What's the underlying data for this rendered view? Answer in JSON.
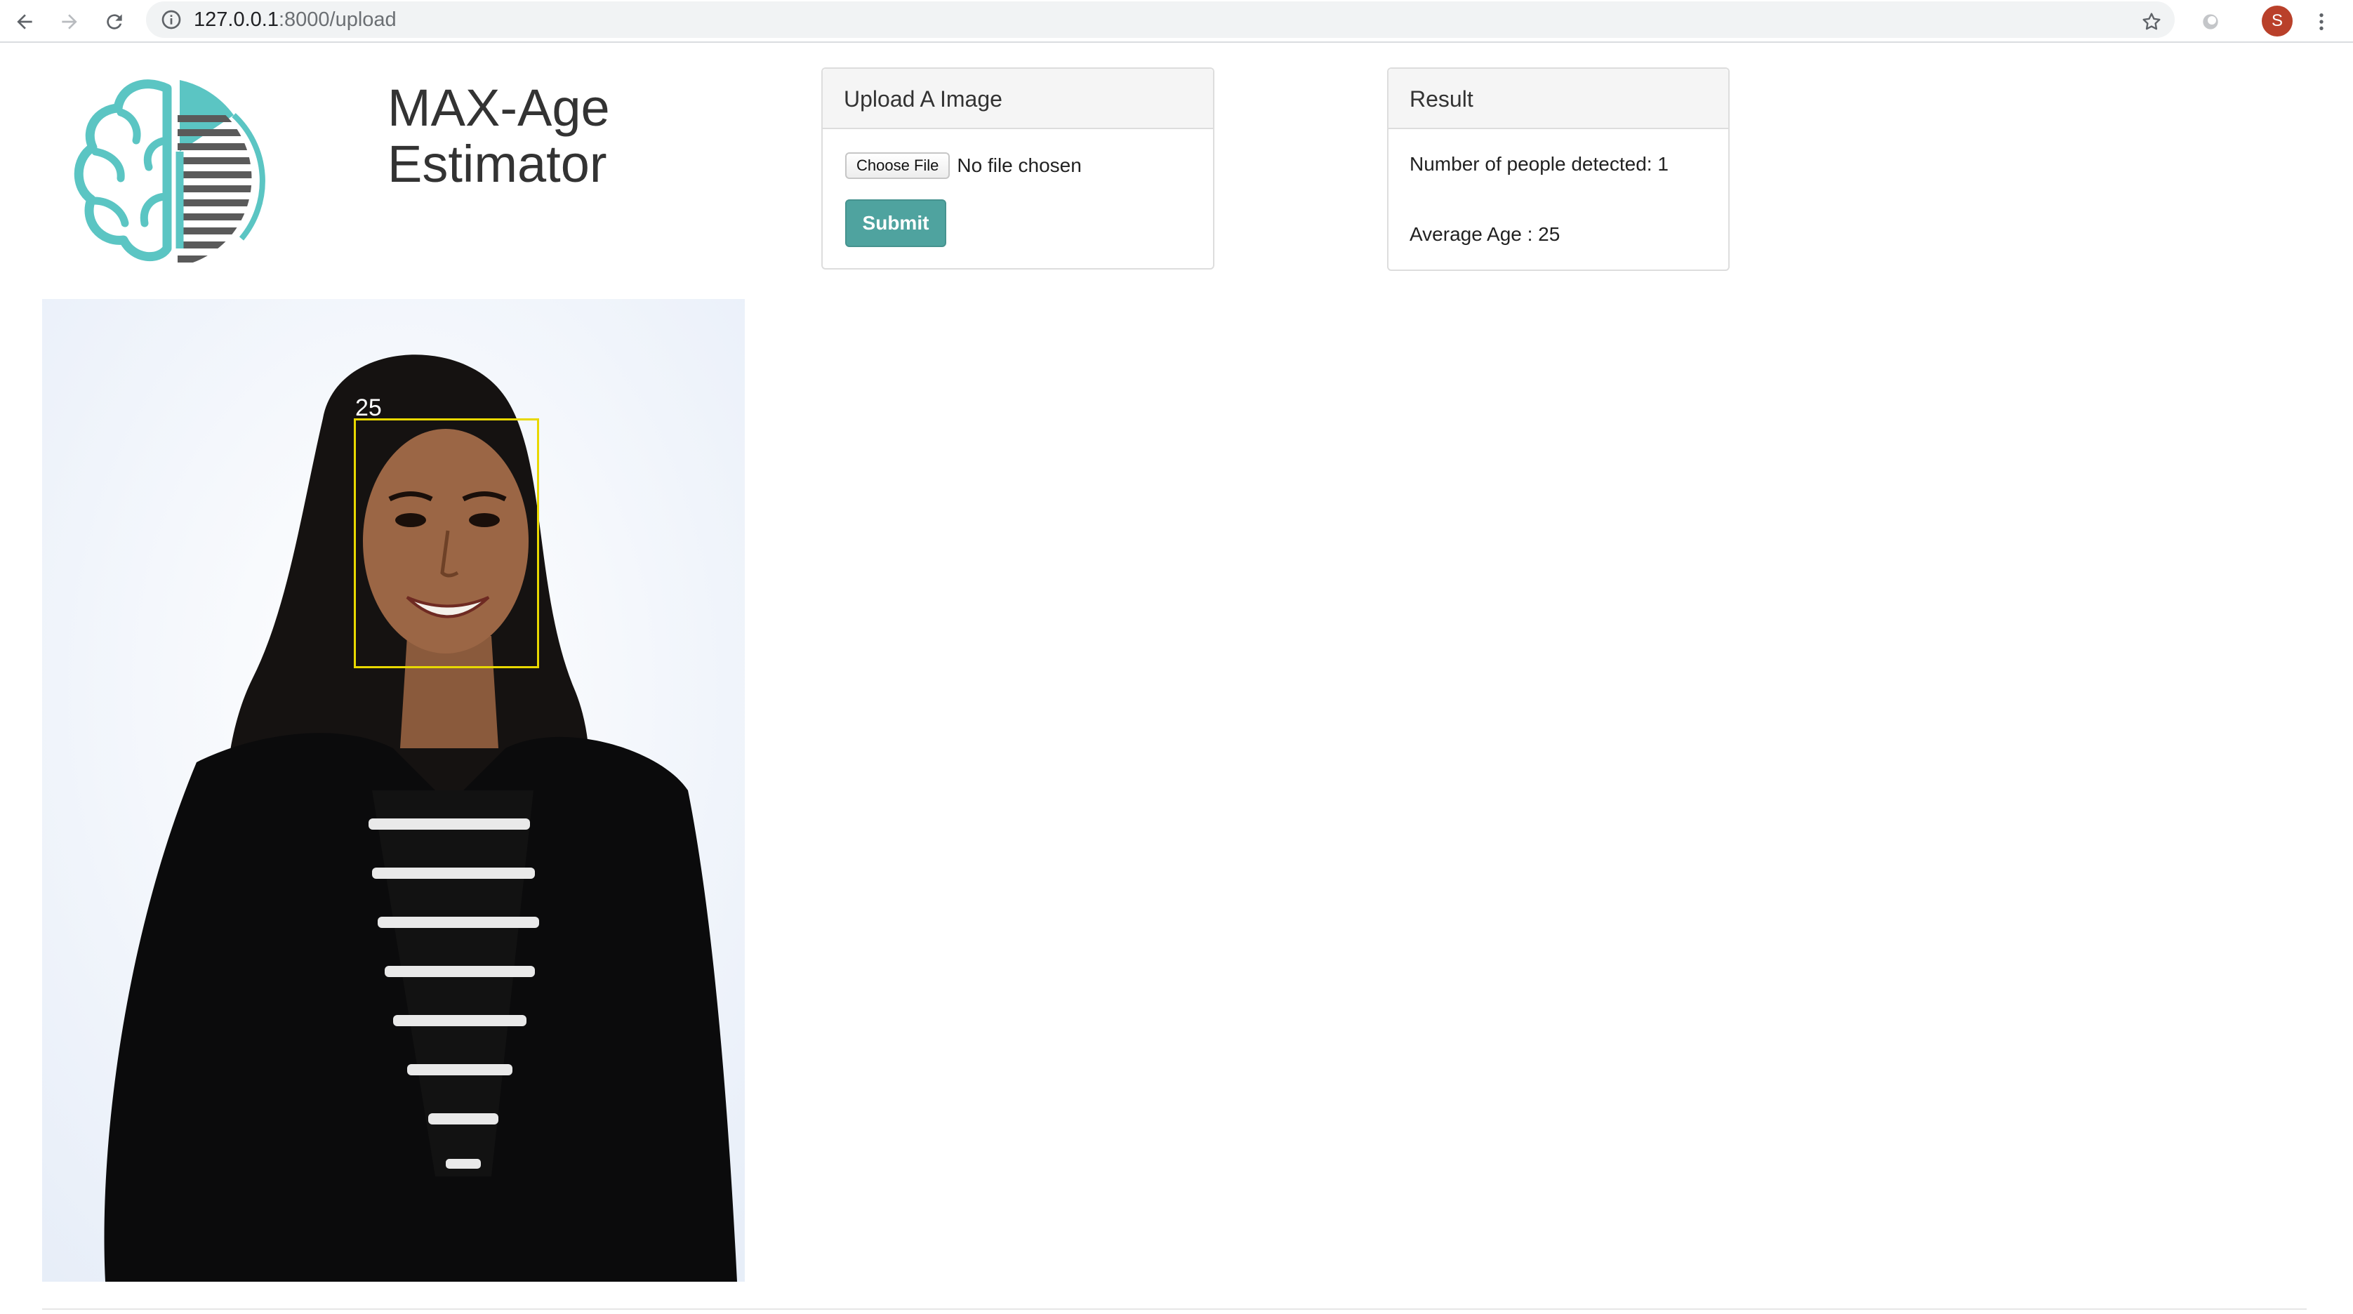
{
  "browser": {
    "url_host": "127.0.0.1",
    "url_path": ":8000/upload",
    "profile_initial": "S"
  },
  "app": {
    "title_line1": "MAX-Age",
    "title_line2": "Estimator",
    "brand_color": "#5bc5c3"
  },
  "upload_panel": {
    "heading": "Upload A Image",
    "choose_file_label": "Choose File",
    "file_status": "No file chosen",
    "submit_label": "Submit",
    "submit_color": "#4fa39f"
  },
  "result_panel": {
    "heading": "Result",
    "people_detected": "Number of people detected: 1",
    "average_age": "Average Age : 25"
  },
  "result_image": {
    "detections": [
      {
        "age_label": "25",
        "box_color": "#e8d800"
      }
    ]
  }
}
